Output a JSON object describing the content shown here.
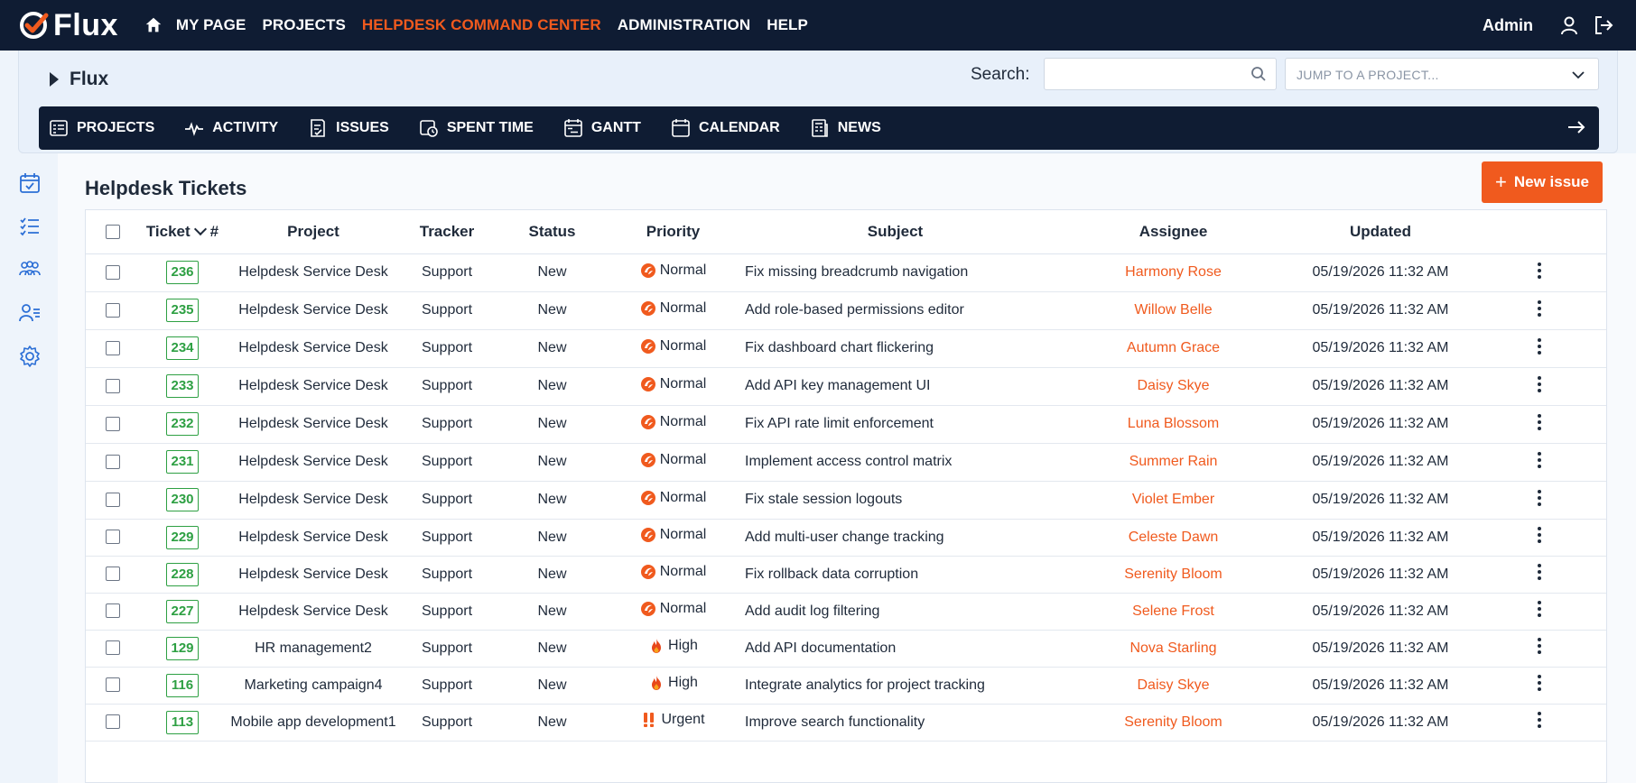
{
  "app": {
    "logo_text": "Flux",
    "nav": [
      "MY PAGE",
      "PROJECTS",
      "HELPDESK COMMAND CENTER",
      "ADMINISTRATION",
      "HELP"
    ],
    "active_nav": "HELPDESK COMMAND CENTER",
    "user": "Admin",
    "accent_color": "#f05a1e",
    "nav_bg": "#0f1c33"
  },
  "project": {
    "title": "Flux",
    "search_label": "Search:",
    "search_value": "",
    "jump_placeholder": "JUMP TO A PROJECT...",
    "menu": [
      {
        "label": "PROJECTS",
        "icon": "projects-icon"
      },
      {
        "label": "ACTIVITY",
        "icon": "activity-icon"
      },
      {
        "label": "ISSUES",
        "icon": "issues-icon"
      },
      {
        "label": "SPENT TIME",
        "icon": "spent-time-icon"
      },
      {
        "label": "GANTT",
        "icon": "gantt-icon"
      },
      {
        "label": "CALENDAR",
        "icon": "calendar-icon"
      },
      {
        "label": "NEWS",
        "icon": "news-icon"
      }
    ]
  },
  "sidebar": {
    "icons": [
      "calendar-check-icon",
      "checklist-icon",
      "team-icon",
      "user-list-icon",
      "gear-icon"
    ]
  },
  "main": {
    "title": "Helpdesk Tickets",
    "new_issue_label": "New issue",
    "columns": {
      "ticket": "Ticket",
      "hash": "#",
      "project": "Project",
      "tracker": "Tracker",
      "status": "Status",
      "priority": "Priority",
      "subject": "Subject",
      "assignee": "Assignee",
      "updated": "Updated"
    },
    "rows": [
      {
        "id": "236",
        "project": "Helpdesk Service Desk",
        "tracker": "Support",
        "status": "New",
        "priority": "Normal",
        "subject": "Fix missing breadcrumb navigation",
        "assignee": "Harmony Rose",
        "updated": "05/19/2026 11:32 AM"
      },
      {
        "id": "235",
        "project": "Helpdesk Service Desk",
        "tracker": "Support",
        "status": "New",
        "priority": "Normal",
        "subject": "Add role-based permissions editor",
        "assignee": "Willow Belle",
        "updated": "05/19/2026 11:32 AM"
      },
      {
        "id": "234",
        "project": "Helpdesk Service Desk",
        "tracker": "Support",
        "status": "New",
        "priority": "Normal",
        "subject": "Fix dashboard chart flickering",
        "assignee": "Autumn Grace",
        "updated": "05/19/2026 11:32 AM"
      },
      {
        "id": "233",
        "project": "Helpdesk Service Desk",
        "tracker": "Support",
        "status": "New",
        "priority": "Normal",
        "subject": "Add API key management UI",
        "assignee": "Daisy Skye",
        "updated": "05/19/2026 11:32 AM"
      },
      {
        "id": "232",
        "project": "Helpdesk Service Desk",
        "tracker": "Support",
        "status": "New",
        "priority": "Normal",
        "subject": "Fix API rate limit enforcement",
        "assignee": "Luna Blossom",
        "updated": "05/19/2026 11:32 AM"
      },
      {
        "id": "231",
        "project": "Helpdesk Service Desk",
        "tracker": "Support",
        "status": "New",
        "priority": "Normal",
        "subject": "Implement access control matrix",
        "assignee": "Summer Rain",
        "updated": "05/19/2026 11:32 AM"
      },
      {
        "id": "230",
        "project": "Helpdesk Service Desk",
        "tracker": "Support",
        "status": "New",
        "priority": "Normal",
        "subject": "Fix stale session logouts",
        "assignee": "Violet Ember",
        "updated": "05/19/2026 11:32 AM"
      },
      {
        "id": "229",
        "project": "Helpdesk Service Desk",
        "tracker": "Support",
        "status": "New",
        "priority": "Normal",
        "subject": "Add multi-user change tracking",
        "assignee": "Celeste Dawn",
        "updated": "05/19/2026 11:32 AM"
      },
      {
        "id": "228",
        "project": "Helpdesk Service Desk",
        "tracker": "Support",
        "status": "New",
        "priority": "Normal",
        "subject": "Fix rollback data corruption",
        "assignee": "Serenity Bloom",
        "updated": "05/19/2026 11:32 AM"
      },
      {
        "id": "227",
        "project": "Helpdesk Service Desk",
        "tracker": "Support",
        "status": "New",
        "priority": "Normal",
        "subject": "Add audit log filtering",
        "assignee": "Selene Frost",
        "updated": "05/19/2026 11:32 AM"
      },
      {
        "id": "129",
        "project": "HR management2",
        "tracker": "Support",
        "status": "New",
        "priority": "High",
        "subject": "Add API documentation",
        "assignee": "Nova Starling",
        "updated": "05/19/2026 11:32 AM"
      },
      {
        "id": "116",
        "project": "Marketing campaign4",
        "tracker": "Support",
        "status": "New",
        "priority": "High",
        "subject": "Integrate analytics for project tracking",
        "assignee": "Daisy Skye",
        "updated": "05/19/2026 11:32 AM"
      },
      {
        "id": "113",
        "project": "Mobile app development1",
        "tracker": "Support",
        "status": "New",
        "priority": "Urgent",
        "subject": "Improve search functionality",
        "assignee": "Serenity Bloom",
        "updated": "05/19/2026 11:32 AM"
      }
    ]
  }
}
